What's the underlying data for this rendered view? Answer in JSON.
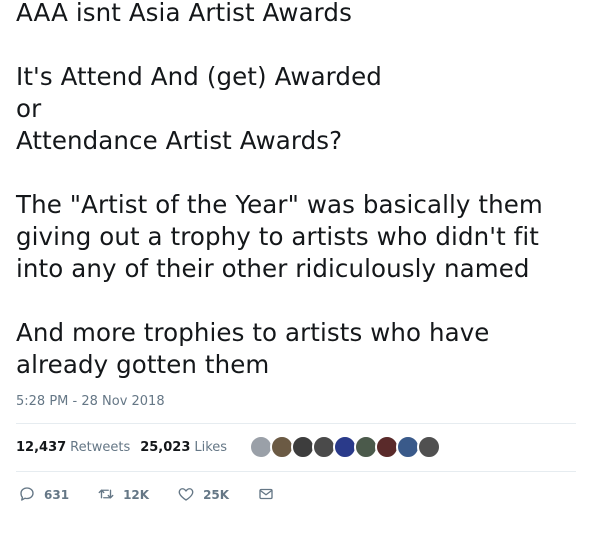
{
  "tweet": {
    "lines": [
      "AAA isnt Asia Artist Awards",
      "",
      "It's Attend And (get) Awarded",
      "or",
      "Attendance Artist Awards?",
      "",
      "The \"Artist of the Year\" was basically them",
      "giving out a trophy to artists who didn't fit",
      "into any of their other ridiculously named",
      "",
      "And more trophies to artists who have",
      "already gotten them"
    ],
    "timestamp": "5:28 PM - 28 Nov 2018"
  },
  "stats": {
    "retweets_count": "12,437",
    "retweets_label": "Retweets",
    "likes_count": "25,023",
    "likes_label": "Likes"
  },
  "likers": {
    "avatar_colors": [
      "#9aa0a8",
      "#6b5a44",
      "#3d3d3d",
      "#4a4a4a",
      "#2a3a8a",
      "#4b5a4b",
      "#5a2a2a",
      "#3a5a8a",
      "#505050"
    ]
  },
  "actions": {
    "reply_icon": "reply-icon",
    "reply_count": "631",
    "retweet_icon": "retweet-icon",
    "retweet_count": "12K",
    "like_icon": "heart-icon",
    "like_count": "25K",
    "message_icon": "envelope-icon"
  },
  "colors": {
    "text": "#14171a",
    "secondary": "#657786",
    "divider": "#e6ecf0"
  }
}
